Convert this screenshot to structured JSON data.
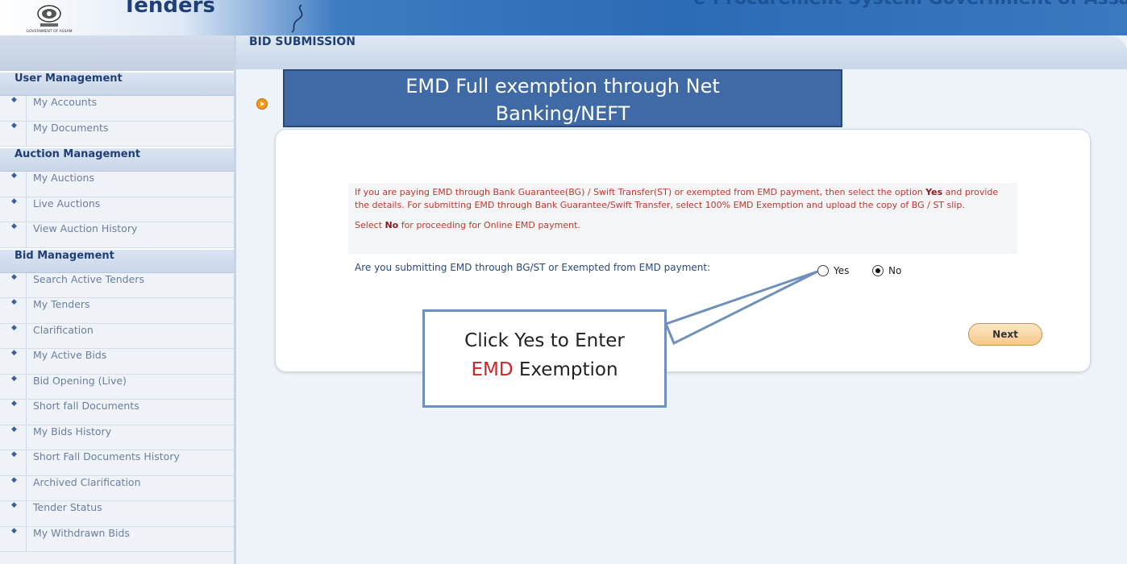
{
  "header": {
    "brand": "Tenders",
    "logo_text": "GOVERNMENT OF ASSAM",
    "right_title": "e-Procurement System Government of Assam"
  },
  "sidebar": {
    "sections": [
      {
        "title": "User Management",
        "items": [
          "My Accounts",
          "My Documents"
        ]
      },
      {
        "title": "Auction Management",
        "items": [
          "My Auctions",
          "Live Auctions",
          "View Auction History"
        ]
      },
      {
        "title": "Bid Management",
        "items": [
          "Search Active Tenders",
          "My Tenders",
          "Clarification",
          "My Active Bids",
          "Bid Opening (Live)",
          "Short fall Documents",
          "My Bids History",
          "Short Fall Documents History",
          "Archived Clarification",
          "Tender Status",
          "My Withdrawn Bids"
        ]
      }
    ]
  },
  "main": {
    "title": "BID SUBMISSION",
    "banner_line1": "EMD Full exemption through Net",
    "banner_line2": "Banking/NEFT",
    "info_text_1a": "If you are paying EMD through Bank Guarantee(BG) / Swift Transfer(ST) or exempted from EMD payment, then select the option ",
    "info_yes": "Yes",
    "info_text_1b": " and provide the details. For submitting EMD through Bank Guarantee/Swift Transfer, select 100% EMD Exemption and upload the copy of BG / ST slip.",
    "info_text_2a": "Select ",
    "info_no": "No",
    "info_text_2b": " for proceeding for Online EMD payment.",
    "question": "Are you submitting EMD through BG/ST or Exempted from EMD payment:",
    "option_yes": "Yes",
    "option_no": "No",
    "selected_option": "No",
    "next_label": "Next"
  },
  "callout": {
    "line1": "Click Yes to Enter",
    "line2_highlight": "EMD",
    "line2_rest": " Exemption"
  }
}
